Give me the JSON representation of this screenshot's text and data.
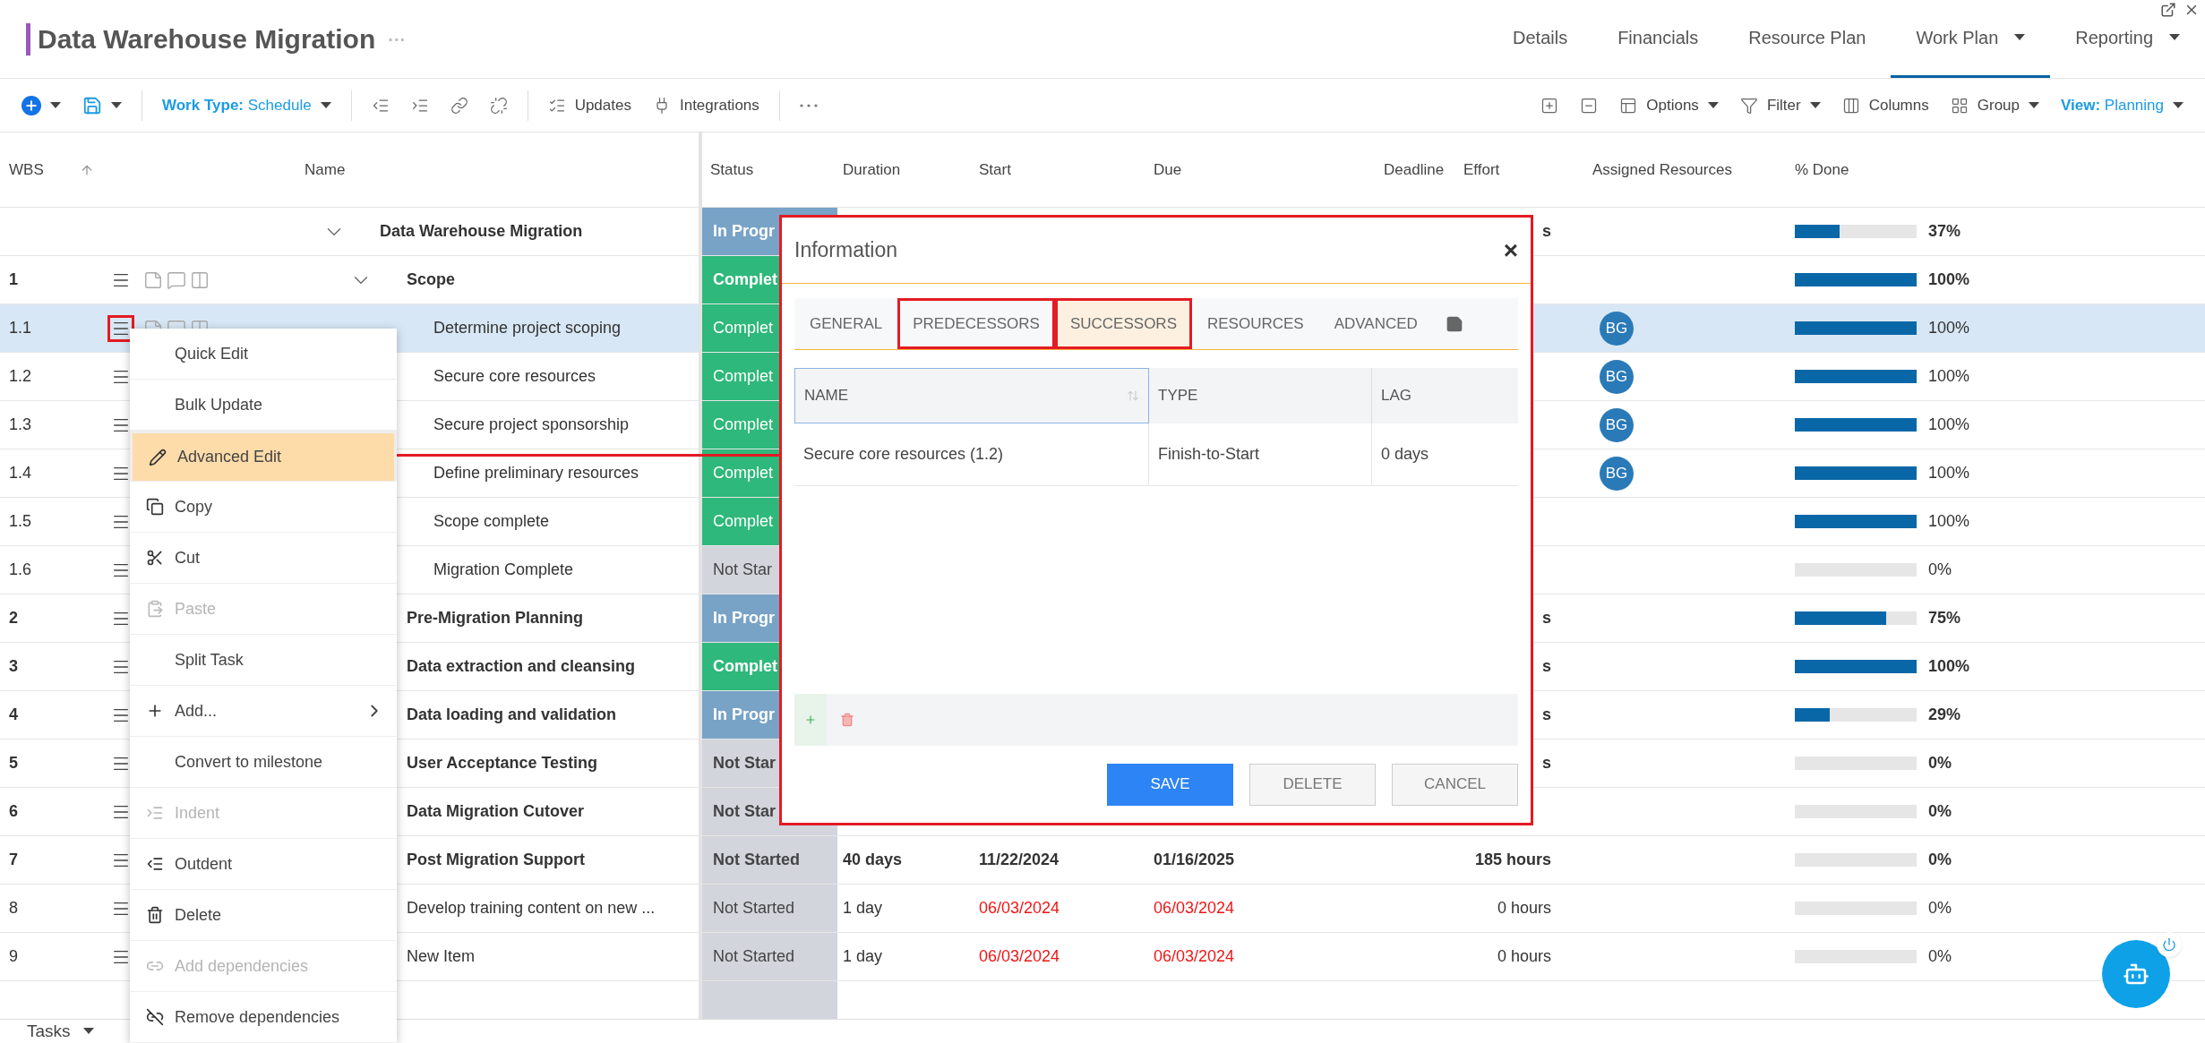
{
  "title": {
    "text": "Data Warehouse Migration",
    "more": "···"
  },
  "nav_tabs": [
    {
      "label": "Details",
      "selected": false,
      "dropdown": false
    },
    {
      "label": "Financials",
      "selected": false,
      "dropdown": false
    },
    {
      "label": "Resource Plan",
      "selected": false,
      "dropdown": false
    },
    {
      "label": "Work Plan",
      "selected": true,
      "dropdown": true
    },
    {
      "label": "Reporting",
      "selected": false,
      "dropdown": true
    }
  ],
  "toolbar": {
    "left": [
      {
        "kind": "add"
      },
      {
        "kind": "save"
      },
      {
        "kind": "work_type",
        "label": "Work Type:",
        "value": "Schedule"
      },
      {
        "kind": "outdent"
      },
      {
        "kind": "indent"
      },
      {
        "kind": "link"
      },
      {
        "kind": "unlink"
      },
      {
        "kind": "updates",
        "label": "Updates"
      },
      {
        "kind": "integrations",
        "label": "Integrations"
      },
      {
        "kind": "more"
      }
    ],
    "right": [
      {
        "kind": "expand_all"
      },
      {
        "kind": "collapse_all"
      },
      {
        "kind": "options",
        "label": "Options"
      },
      {
        "kind": "filter",
        "label": "Filter"
      },
      {
        "kind": "columns",
        "label": "Columns"
      },
      {
        "kind": "group",
        "label": "Group"
      },
      {
        "kind": "view",
        "label": "View:",
        "value": "Planning"
      }
    ]
  },
  "columns": [
    "WBS",
    "Name",
    "Status",
    "Duration",
    "Start",
    "Due",
    "Deadline",
    "Effort",
    "Assigned Resources",
    "% Done"
  ],
  "rows": [
    {
      "wbs": "",
      "name": "Data Warehouse Migration",
      "kind": "project",
      "expanded": true,
      "selected": false,
      "status": {
        "text": "In Progr",
        "kind": "in_progress"
      },
      "effort": "s",
      "level": 0.37,
      "pct": "37%",
      "children": [
        {
          "wbs": "1",
          "name": "Scope",
          "kind": "summary",
          "expanded": true,
          "selected": false,
          "indicators": true,
          "status": {
            "text": "Complet",
            "kind": "complete"
          },
          "level": 1,
          "pct": "100%",
          "children": [
            {
              "wbs": "1.1",
              "name": "Determine project scoping",
              "kind": "task",
              "selected": true,
              "marked": true,
              "indicators": true,
              "status": {
                "text": "Complet",
                "kind": "complete"
              },
              "resources": [
                "BG"
              ],
              "level": 1,
              "pct": "100%"
            },
            {
              "wbs": "1.2",
              "name": "Secure core resources",
              "kind": "task",
              "selected": false,
              "status": {
                "text": "Complet",
                "kind": "complete"
              },
              "resources": [
                "BG"
              ],
              "level": 1,
              "pct": "100%"
            },
            {
              "wbs": "1.3",
              "name": "Secure project sponsorship",
              "kind": "task",
              "selected": false,
              "status": {
                "text": "Complet",
                "kind": "complete"
              },
              "resources": [
                "BG"
              ],
              "level": 1,
              "pct": "100%"
            },
            {
              "wbs": "1.4",
              "name": "Define preliminary resources",
              "kind": "task",
              "selected": false,
              "status": {
                "text": "Complet",
                "kind": "complete"
              },
              "resources": [
                "BG"
              ],
              "level": 1,
              "pct": "100%"
            },
            {
              "wbs": "1.5",
              "name": "Scope complete",
              "kind": "task",
              "selected": false,
              "status": {
                "text": "Complet",
                "kind": "complete"
              },
              "level": 1,
              "pct": "100%"
            },
            {
              "wbs": "1.6",
              "name": "Migration Complete",
              "kind": "task",
              "selected": false,
              "status": {
                "text": "Not Star",
                "kind": "not_started"
              },
              "level": 0,
              "pct": "0%"
            }
          ]
        },
        {
          "wbs": "2",
          "name": "Pre-Migration Planning",
          "kind": "summary",
          "selected": false,
          "status": {
            "text": "In Progr",
            "kind": "in_progress"
          },
          "effort": "s",
          "level": 0.75,
          "pct": "75%"
        },
        {
          "wbs": "3",
          "name": "Data extraction and cleansing",
          "kind": "summary",
          "selected": false,
          "status": {
            "text": "Complet",
            "kind": "complete"
          },
          "effort": "s",
          "level": 1,
          "pct": "100%"
        },
        {
          "wbs": "4",
          "name": "Data loading and validation",
          "kind": "summary",
          "selected": false,
          "status": {
            "text": "In Progr",
            "kind": "in_progress"
          },
          "effort": "s",
          "level": 0.29,
          "pct": "29%"
        },
        {
          "wbs": "5",
          "name": "User Acceptance Testing",
          "kind": "summary",
          "selected": false,
          "status": {
            "text": "Not Star",
            "kind": "not_started"
          },
          "effort": "s",
          "level": 0,
          "pct": "0%"
        },
        {
          "wbs": "6",
          "name": "Data Migration Cutover",
          "kind": "summary",
          "selected": false,
          "status": {
            "text": "Not Star",
            "kind": "not_started"
          },
          "level": 0,
          "pct": "0%"
        },
        {
          "wbs": "7",
          "name": "Post Migration Support",
          "kind": "summary",
          "selected": false,
          "status": {
            "text": "Not Started",
            "kind": "not_started"
          },
          "duration": "40 days",
          "start": "11/22/2024",
          "due": "01/16/2025",
          "late": false,
          "effort": "185 hours",
          "level": 0,
          "pct": "0%"
        },
        {
          "wbs": "8",
          "name": "Develop training content on new ...",
          "kind": "task",
          "selected": false,
          "status": {
            "text": "Not Started",
            "kind": "not_started"
          },
          "duration": "1 day",
          "start": "06/03/2024",
          "due": "06/03/2024",
          "late": true,
          "effort": "0 hours",
          "level": 0,
          "pct": "0%"
        },
        {
          "wbs": "9",
          "name": "New Item",
          "kind": "task",
          "selected": false,
          "status": {
            "text": "Not Started",
            "kind": "not_started"
          },
          "duration": "1 day",
          "start": "06/03/2024",
          "due": "06/03/2024",
          "late": true,
          "effort": "0 hours",
          "level": 0,
          "pct": "0%"
        }
      ]
    }
  ],
  "context_menu": [
    {
      "label": "Quick Edit",
      "kind": "quick_edit",
      "selected": false,
      "disabled": false
    },
    {
      "label": "Bulk Update",
      "kind": "bulk_update",
      "selected": false,
      "disabled": false
    },
    {
      "label": "Advanced Edit",
      "kind": "edit",
      "selected": true,
      "disabled": false
    },
    {
      "label": "Copy",
      "kind": "copy",
      "selected": false,
      "disabled": false
    },
    {
      "label": "Cut",
      "kind": "cut",
      "selected": false,
      "disabled": false
    },
    {
      "label": "Paste",
      "kind": "paste",
      "selected": false,
      "disabled": true
    },
    {
      "label": "Split Task",
      "kind": "split",
      "selected": false,
      "disabled": false
    },
    {
      "label": "Add...",
      "kind": "add",
      "selected": false,
      "disabled": false
    },
    {
      "label": "Convert to milestone",
      "kind": "convert",
      "selected": false,
      "disabled": false
    },
    {
      "label": "Indent",
      "kind": "indent",
      "selected": false,
      "disabled": true
    },
    {
      "label": "Outdent",
      "kind": "outdent",
      "selected": false,
      "disabled": false
    },
    {
      "label": "Delete",
      "kind": "delete",
      "selected": false,
      "disabled": false
    },
    {
      "label": "Add dependencies",
      "kind": "add_dependencies",
      "selected": false,
      "disabled": true
    },
    {
      "label": "Remove dependencies",
      "kind": "remove_dependencies",
      "selected": false,
      "disabled": false
    }
  ],
  "dialog": {
    "title": "Information",
    "close": "×",
    "tabs": [
      {
        "label": "GENERAL",
        "selected": false,
        "marked": false
      },
      {
        "label": "PREDECESSORS",
        "selected": false,
        "marked": true
      },
      {
        "label": "SUCCESSORS",
        "selected": true,
        "marked": true
      },
      {
        "label": "RESOURCES",
        "selected": false,
        "marked": false
      },
      {
        "label": "ADVANCED",
        "selected": false,
        "marked": false
      }
    ],
    "table": {
      "columns": [
        "NAME",
        "TYPE",
        "LAG"
      ],
      "rows": [
        [
          "Secure core resources (1.2)",
          "Finish-to-Start",
          "0 days"
        ]
      ]
    },
    "buttons": [
      {
        "label": "SAVE",
        "kind": "primary"
      },
      {
        "label": "DELETE",
        "kind": "secondary"
      },
      {
        "label": "CANCEL",
        "kind": "secondary"
      }
    ]
  },
  "footer": {
    "label": "Tasks"
  }
}
